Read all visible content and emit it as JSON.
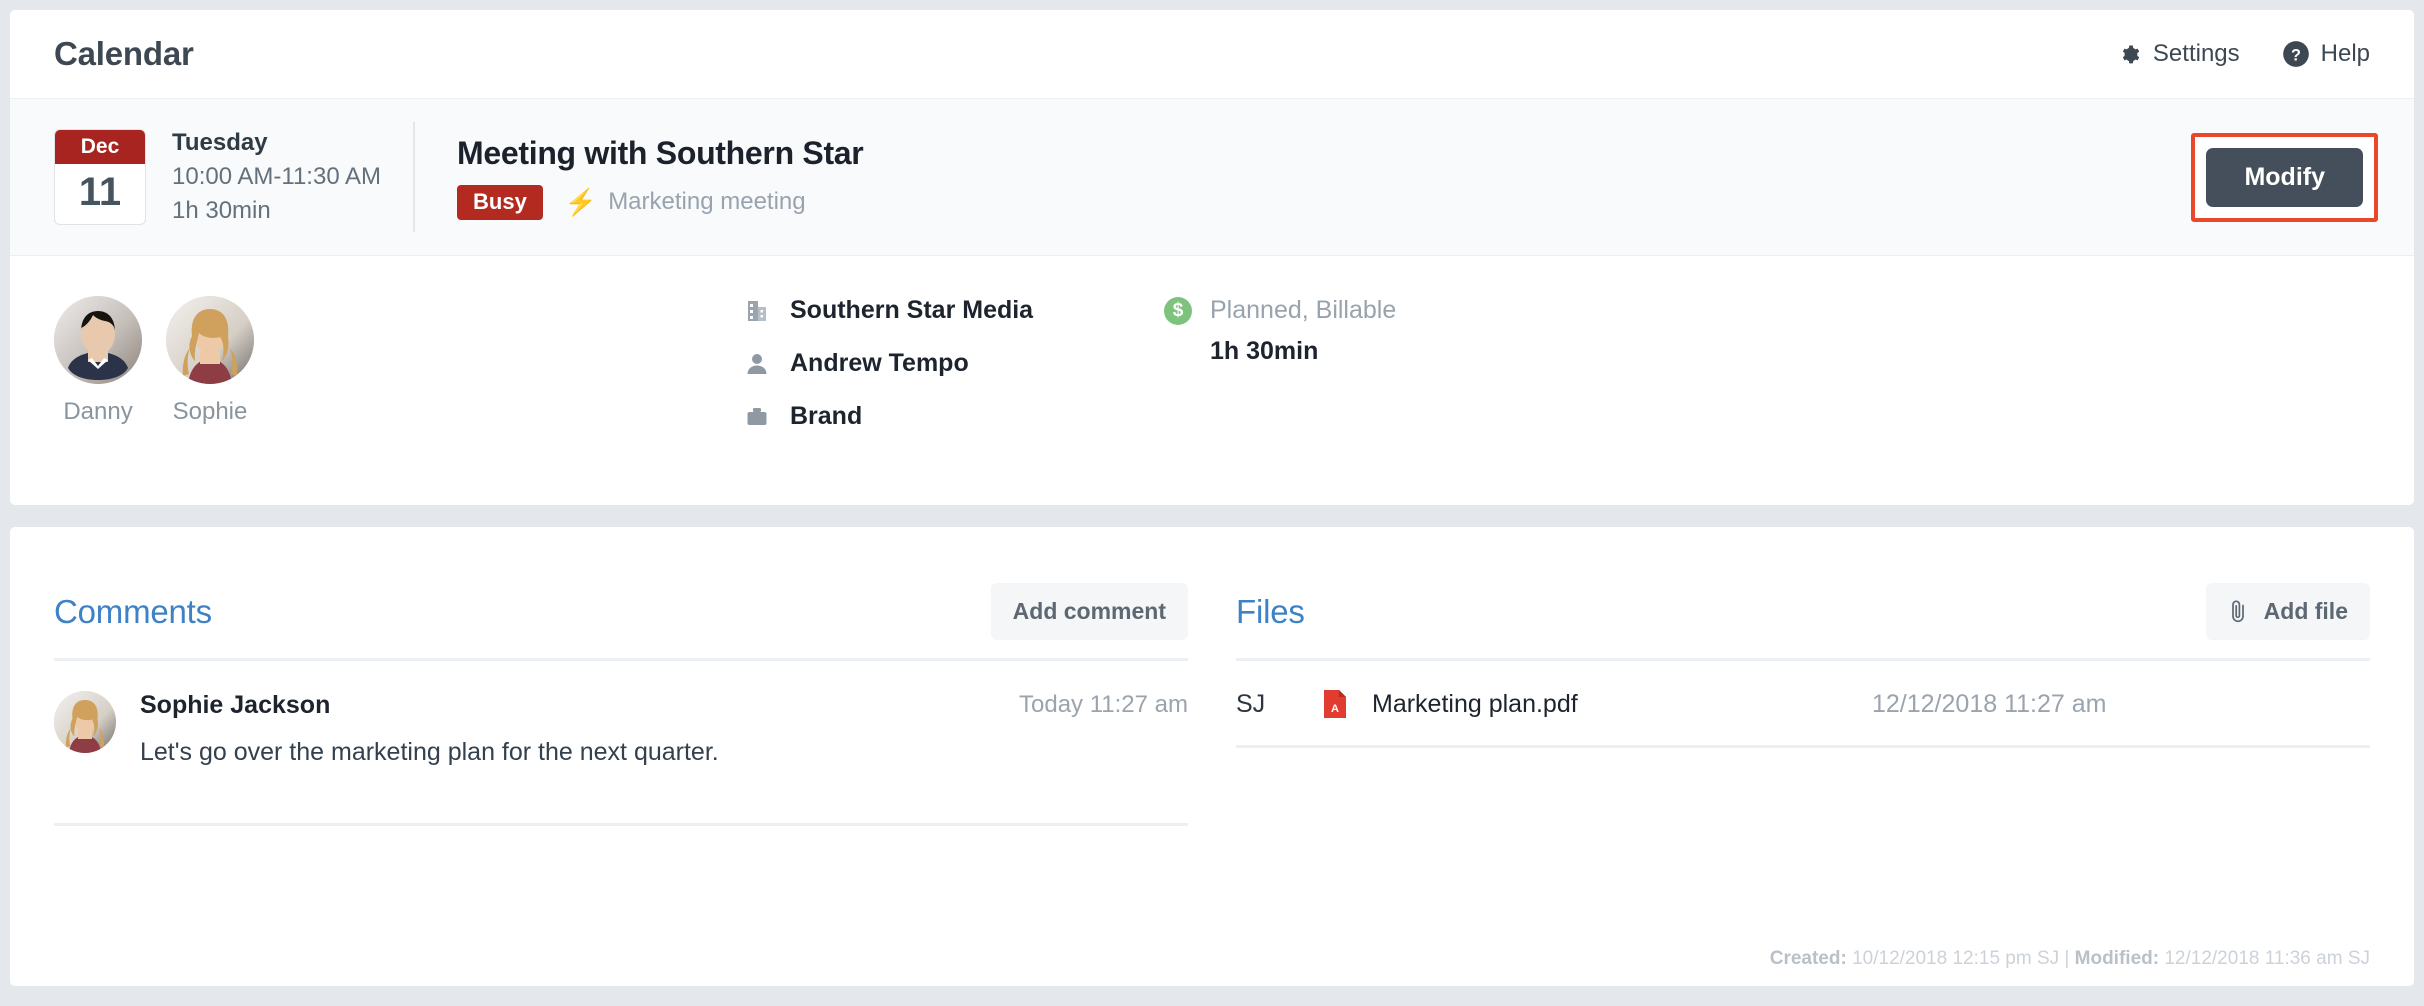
{
  "header": {
    "title": "Calendar",
    "settings_label": "Settings",
    "help_label": "Help"
  },
  "event": {
    "date_month": "Dec",
    "date_day": "11",
    "weekday": "Tuesday",
    "time_range": "10:00 AM-11:30 AM",
    "duration": "1h 30min",
    "title": "Meeting with Southern Star",
    "status_badge": "Busy",
    "type_label": "Marketing meeting",
    "modify_label": "Modify",
    "accent_highlight": "#e9482a",
    "badge_color": "#b32a21"
  },
  "attendees": [
    {
      "name": "Danny"
    },
    {
      "name": "Sophie"
    }
  ],
  "meta": [
    {
      "icon": "building-icon",
      "value": "Southern Star Media"
    },
    {
      "icon": "person-icon",
      "value": "Andrew Tempo"
    },
    {
      "icon": "briefcase-icon",
      "value": "Brand"
    }
  ],
  "billing": {
    "icon": "dollar-coin-icon",
    "label": "Planned, Billable",
    "value": "1h 30min",
    "color": "#7dc37d"
  },
  "comments": {
    "title": "Comments",
    "add_label": "Add comment",
    "items": [
      {
        "author": "Sophie Jackson",
        "time": "Today 11:27 am",
        "text": "Let's go over the marketing plan for the next quarter."
      }
    ]
  },
  "files": {
    "title": "Files",
    "add_label": "Add file",
    "items": [
      {
        "initials": "SJ",
        "name": "Marketing plan.pdf",
        "date": "12/12/2018 11:27 am",
        "type": "pdf"
      }
    ]
  },
  "footer": {
    "created_label": "Created:",
    "created_value": "10/12/2018 12:15 pm SJ",
    "separator": "|",
    "modified_label": "Modified:",
    "modified_value": "12/12/2018 11:36 am SJ"
  }
}
